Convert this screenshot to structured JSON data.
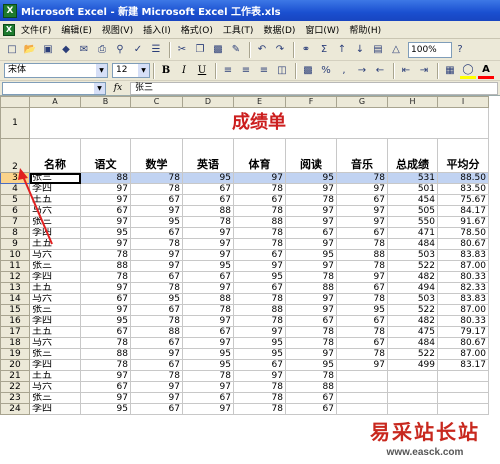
{
  "window": {
    "app_icon": "X",
    "title": "Microsoft Excel - 新建 Microsoft Excel 工作表.xls"
  },
  "menu": {
    "doc_icon": "X",
    "items": [
      "文件(F)",
      "编辑(E)",
      "视图(V)",
      "插入(I)",
      "格式(O)",
      "工具(T)",
      "数据(D)",
      "窗口(W)",
      "帮助(H)"
    ]
  },
  "standard_toolbar": {
    "icons": [
      "new-icon",
      "open-icon",
      "save-icon",
      "permission-icon",
      "email-icon",
      "print-icon",
      "print-preview-icon",
      "spelling-icon",
      "research-icon",
      "cut-icon",
      "copy-icon",
      "paste-icon",
      "format-painter-icon",
      "undo-icon",
      "redo-icon",
      "hyperlink-icon",
      "autosum-icon",
      "sort-ascending-icon",
      "sort-descending-icon",
      "chart-wizard-icon",
      "drawing-icon"
    ],
    "zoom": "100%"
  },
  "formatting_toolbar": {
    "font": "宋体",
    "size": "12",
    "bold": "B",
    "italic": "I",
    "underline": "U",
    "currency": "%",
    "accent_fill": "#ffff00",
    "accent_font": "#ff0000"
  },
  "formula_bar": {
    "name_box": "",
    "fx": "fx",
    "content": "张三"
  },
  "columns": [
    "A",
    "B",
    "C",
    "D",
    "E",
    "F",
    "G",
    "H",
    "I"
  ],
  "sheet": {
    "title": "成绩单",
    "title_color": "#cc1e1e",
    "headers": [
      "名称",
      "语文",
      "数学",
      "英语",
      "体育",
      "阅读",
      "音乐",
      "总成绩",
      "平均分"
    ],
    "rows": [
      [
        "3",
        "张三",
        "88",
        "78",
        "95",
        "97",
        "95",
        "78",
        "531",
        "88.50"
      ],
      [
        "4",
        "李四",
        "97",
        "78",
        "67",
        "78",
        "97",
        "97",
        "501",
        "83.50"
      ],
      [
        "5",
        "王五",
        "97",
        "67",
        "67",
        "67",
        "78",
        "67",
        "454",
        "75.67"
      ],
      [
        "6",
        "马六",
        "67",
        "97",
        "88",
        "78",
        "97",
        "97",
        "505",
        "84.17"
      ],
      [
        "7",
        "张三",
        "97",
        "95",
        "78",
        "88",
        "97",
        "97",
        "550",
        "91.67"
      ],
      [
        "8",
        "李四",
        "95",
        "67",
        "97",
        "78",
        "67",
        "67",
        "471",
        "78.50"
      ],
      [
        "9",
        "王五",
        "97",
        "78",
        "97",
        "78",
        "97",
        "78",
        "484",
        "80.67"
      ],
      [
        "10",
        "马六",
        "78",
        "97",
        "97",
        "67",
        "95",
        "88",
        "503",
        "83.83"
      ],
      [
        "11",
        "张三",
        "88",
        "97",
        "95",
        "97",
        "97",
        "78",
        "522",
        "87.00"
      ],
      [
        "12",
        "李四",
        "78",
        "67",
        "67",
        "95",
        "78",
        "97",
        "482",
        "80.33"
      ],
      [
        "13",
        "王五",
        "97",
        "78",
        "97",
        "67",
        "88",
        "67",
        "494",
        "82.33"
      ],
      [
        "14",
        "马六",
        "67",
        "95",
        "88",
        "78",
        "97",
        "78",
        "503",
        "83.83"
      ],
      [
        "15",
        "张三",
        "97",
        "67",
        "78",
        "88",
        "97",
        "95",
        "522",
        "87.00"
      ],
      [
        "16",
        "李四",
        "95",
        "78",
        "97",
        "78",
        "67",
        "67",
        "482",
        "80.33"
      ],
      [
        "17",
        "王五",
        "67",
        "88",
        "67",
        "97",
        "78",
        "78",
        "475",
        "79.17"
      ],
      [
        "18",
        "马六",
        "78",
        "67",
        "97",
        "95",
        "78",
        "67",
        "484",
        "80.67"
      ],
      [
        "19",
        "张三",
        "88",
        "97",
        "95",
        "95",
        "97",
        "78",
        "522",
        "87.00"
      ],
      [
        "20",
        "李四",
        "78",
        "67",
        "95",
        "67",
        "95",
        "97",
        "499",
        "83.17"
      ],
      [
        "21",
        "王五",
        "97",
        "78",
        "78",
        "97",
        "78",
        "",
        "",
        ""
      ],
      [
        "22",
        "马六",
        "67",
        "97",
        "97",
        "78",
        "88",
        "",
        "",
        ""
      ],
      [
        "23",
        "张三",
        "97",
        "97",
        "67",
        "78",
        "67",
        "",
        "",
        ""
      ],
      [
        "24",
        "李四",
        "95",
        "67",
        "97",
        "78",
        "67",
        "",
        "",
        ""
      ]
    ]
  },
  "watermark": {
    "brand": "易采站长站",
    "url": "www.easck.com"
  }
}
